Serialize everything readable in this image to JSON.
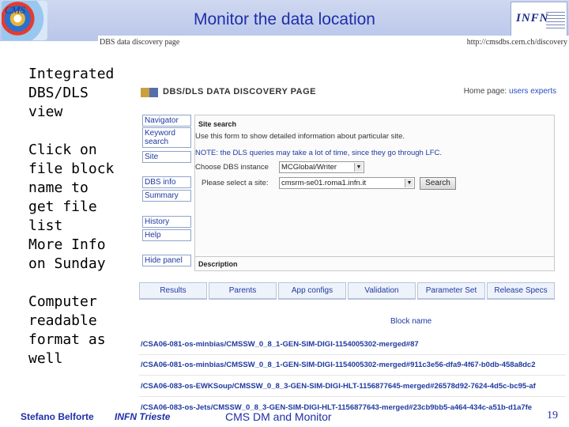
{
  "slide": {
    "title": "Monitor the data location",
    "logo_left_text": "CMS",
    "logo_right_text": "INFN"
  },
  "bullets": [
    "Integrated DBS/DLS view",
    "Click on file block name to get file list",
    "More Info on Sunday",
    "Computer readable format as well"
  ],
  "screenshot": {
    "top_left": "DBS data discovery page",
    "top_right": "http://cmsdbs.cern.ch/discovery",
    "page_title": "DBS/DLS DATA DISCOVERY PAGE",
    "home_label": "Home page:",
    "home_links": "users experts",
    "nav_items": [
      "Navigator",
      "Keyword search",
      "Site",
      "DBS info",
      "Summary",
      "History",
      "Help",
      "Hide panel"
    ],
    "panel": {
      "header": "Site search",
      "info": "Use this form to show detailed information about particular site.",
      "note": "NOTE: the DLS queries may take a lot of time, since they go through LFC.",
      "dbs_label": "Choose DBS instance",
      "dbs_value": "MCGlobal/Writer",
      "site_label": "Please select a site:",
      "site_value": "cmsrm-se01.roma1.infn.it",
      "search_button": "Search",
      "description": "Description"
    },
    "tabs": [
      "Results",
      "Parents",
      "App configs",
      "Validation",
      "Parameter Set",
      "Release Specs"
    ],
    "block_header": "Block name",
    "blocks": [
      "/CSA06-081-os-minbias/CMSSW_0_8_1-GEN-SIM-DIGI-1154005302-merged#87",
      "/CSA06-081-os-minbias/CMSSW_0_8_1-GEN-SIM-DIGI-1154005302-merged#911c3e56-dfa9-4f67-b0db-458a8dc2",
      "/CSA06-083-os-EWKSoup/CMSSW_0_8_3-GEN-SIM-DIGI-HLT-1156877645-merged#26578d92-7624-4d5c-bc95-af",
      "/CSA06-083-os-Jets/CMSSW_0_8_3-GEN-SIM-DIGI-HLT-1156877643-merged#23cb9bb5-a464-434c-a51b-d1a7fe"
    ]
  },
  "footer": {
    "author": "Stefano Belforte",
    "org": "INFN Trieste",
    "center": "CMS DM and Monitor",
    "page": "19"
  }
}
